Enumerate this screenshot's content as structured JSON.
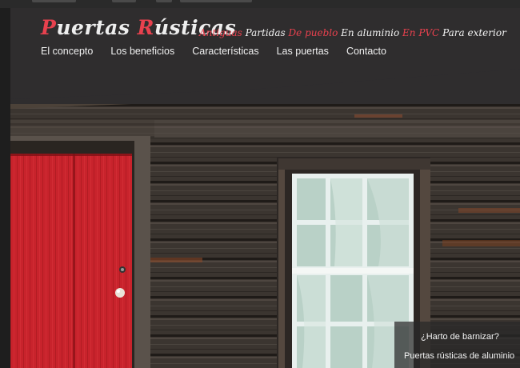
{
  "brand": {
    "logo_part1": "P",
    "logo_part2": "uertas ",
    "logo_part3": "R",
    "logo_part4": "ústicas",
    "accent_color": "#e8414e"
  },
  "tagline": {
    "w1": "Antiguas",
    "w2": "Partidas",
    "w3": "De pueblo",
    "w4": "En aluminio",
    "w5": "En PVC",
    "w6": "Para exterior"
  },
  "nav": {
    "items": [
      {
        "label": "El concepto"
      },
      {
        "label": "Los beneficios"
      },
      {
        "label": "Características"
      },
      {
        "label": "Las puertas"
      },
      {
        "label": "Contacto"
      }
    ]
  },
  "hero": {
    "door_color": "#c8232c",
    "caption_line1": "¿Harto de barnizar?",
    "caption_line2": "Puertas rústicas de aluminio"
  }
}
